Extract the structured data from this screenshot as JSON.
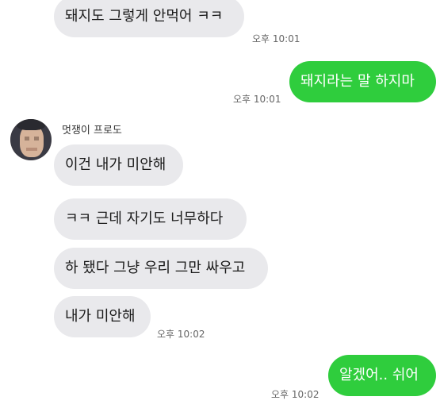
{
  "chat": {
    "sender_name": "멋쟁이 프로도",
    "messages": [
      {
        "side": "in",
        "text": "돼지도 그렇게 안먹어 ㅋㅋ",
        "time": "오후 10:01"
      },
      {
        "side": "out",
        "text": "돼지라는 말 하지마",
        "time": "오후 10:01"
      },
      {
        "side": "in",
        "text": "이건 내가 미안해"
      },
      {
        "side": "in",
        "text": "ㅋㅋ 근데 자기도 너무하다"
      },
      {
        "side": "in",
        "text": "하 됐다 그냥 우리 그만 싸우고"
      },
      {
        "side": "in",
        "text": "내가 미안해",
        "time": "오후 10:02"
      },
      {
        "side": "out",
        "text": "알겠어.. 쉬어",
        "time": "오후 10:02"
      }
    ]
  },
  "colors": {
    "incoming_bubble": "#e9e9ec",
    "outgoing_bubble": "#2fcd3d"
  },
  "icons": {
    "avatar": "blurred-profile-photo"
  }
}
